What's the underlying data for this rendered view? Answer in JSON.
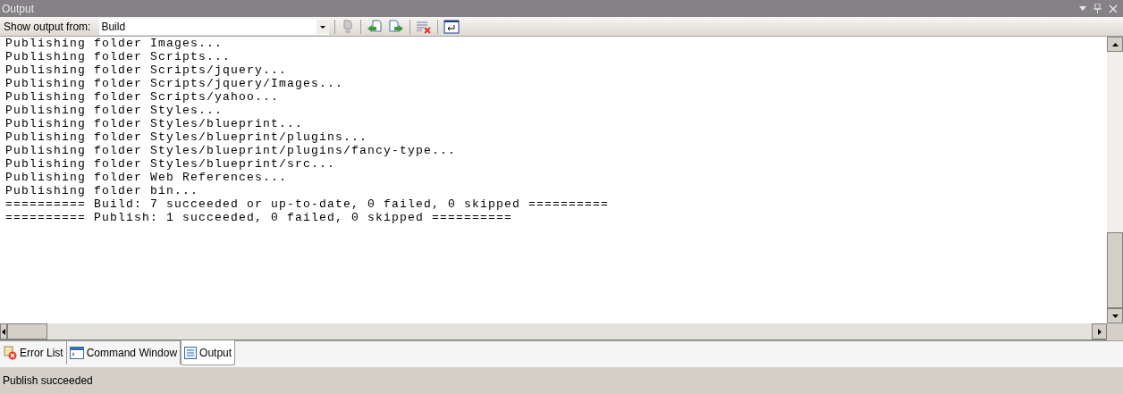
{
  "panel": {
    "title": "Output"
  },
  "toolbar": {
    "label": "Show output from:",
    "source": "Build"
  },
  "output_lines": [
    "Publishing folder Images...",
    "Publishing folder Scripts...",
    "Publishing folder Scripts/jquery...",
    "Publishing folder Scripts/jquery/Images...",
    "Publishing folder Scripts/yahoo...",
    "Publishing folder Styles...",
    "Publishing folder Styles/blueprint...",
    "Publishing folder Styles/blueprint/plugins...",
    "Publishing folder Styles/blueprint/plugins/fancy-type...",
    "Publishing folder Styles/blueprint/src...",
    "Publishing folder Web References...",
    "Publishing folder bin...",
    "========== Build: 7 succeeded or up-to-date, 0 failed, 0 skipped ==========",
    "========== Publish: 1 succeeded, 0 failed, 0 skipped =========="
  ],
  "tabs": [
    {
      "label": "Error List",
      "kind": "errors",
      "selected": false
    },
    {
      "label": "Command Window",
      "kind": "command",
      "selected": false
    },
    {
      "label": "Output",
      "kind": "output",
      "selected": true
    }
  ],
  "status_bar": {
    "text": "Publish succeeded"
  }
}
